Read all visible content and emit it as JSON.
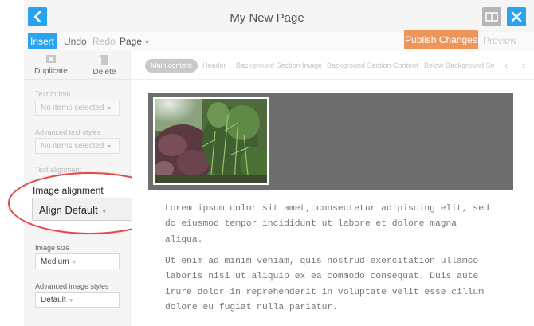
{
  "header": {
    "title": "My New Page"
  },
  "toolbar": {
    "insert_label": "Insert",
    "undo_label": "Undo",
    "redo_label": "Redo",
    "page_label": "Page",
    "publish_label": "Publish Changes",
    "preview_label": "Preview"
  },
  "sidebar": {
    "duplicate_label": "Duplicate",
    "delete_label": "Delete",
    "text_format": {
      "label": "Text format",
      "value": "No items selected"
    },
    "advanced_text_styles": {
      "label": "Advanced text styles",
      "value": "No items selected"
    },
    "text_alignment_label": "Text alignment",
    "image_alignment": {
      "label": "Image alignment",
      "value": "Align Default"
    },
    "image_size": {
      "label": "Image size",
      "value": "Medium"
    },
    "advanced_image_styles": {
      "label": "Advanced image styles",
      "value": "Default"
    }
  },
  "tabs": [
    {
      "label": "Main content"
    },
    {
      "label": "Header"
    },
    {
      "label": "Background Section Image"
    },
    {
      "label": "Background Section Content"
    },
    {
      "label": "Below Background Secti"
    }
  ],
  "content": {
    "paragraph1": "Lorem ipsum dolor sit amet, consectetur adipiscing elit, sed do eiusmod tempor incididunt ut labore et dolore magna aliqua.",
    "paragraph2": "Ut enim ad minim veniam, quis nostrud exercitation ullamco laboris nisi ut aliquip ex ea commodo consequat. Duis aute irure dolor in reprehenderit in voluptate velit esse cillum dolore eu fugiat nulla pariatur."
  },
  "colors": {
    "accent": "#2aa3ef",
    "publish": "#ef9559",
    "callout": "#e24a4a"
  },
  "icons": {
    "back": "chevron-left-icon",
    "layout": "layout-toggle-icon",
    "close": "close-icon",
    "duplicate": "duplicate-icon",
    "delete": "trash-icon"
  }
}
